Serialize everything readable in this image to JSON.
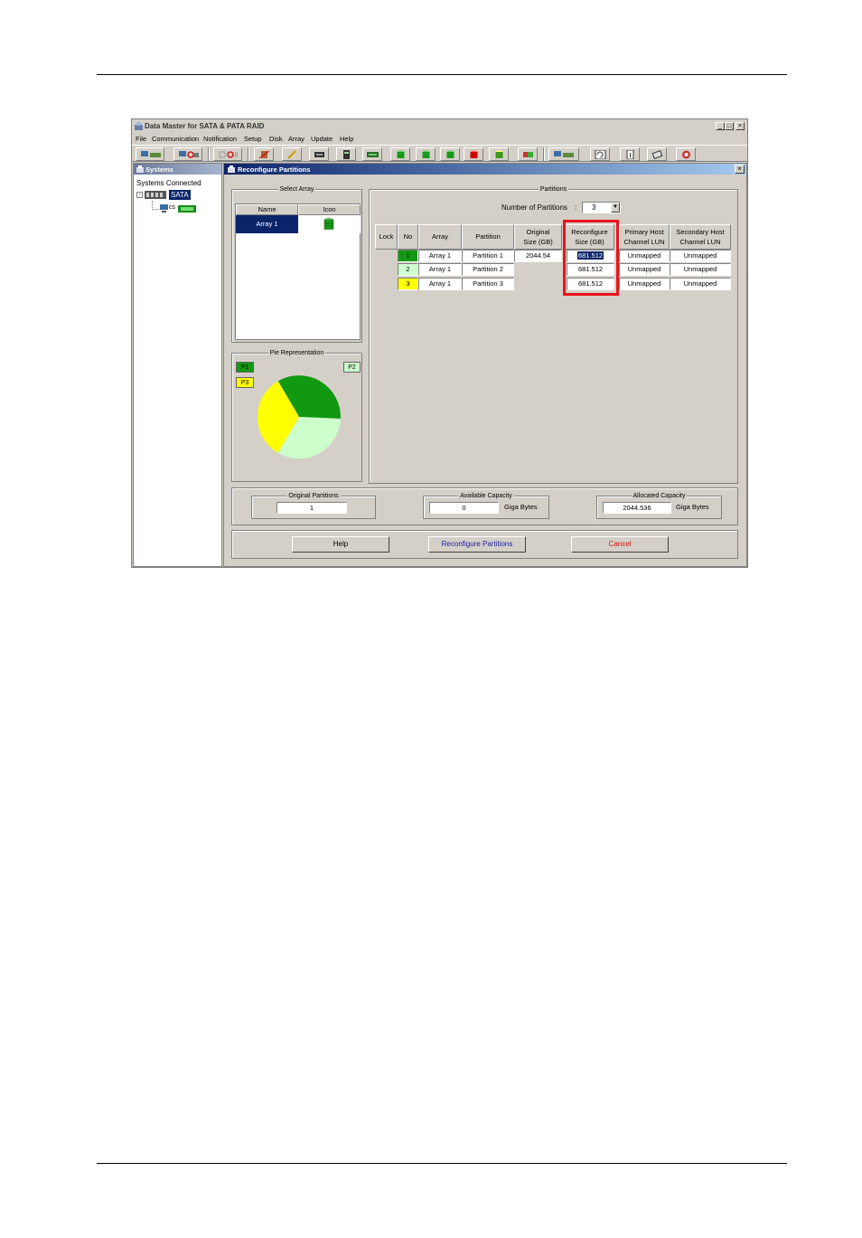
{
  "window": {
    "title": "Data Master for SATA & PATA RAID",
    "controls": {
      "minimize": "_",
      "maximize": "□",
      "close": "×"
    }
  },
  "menu": [
    "File",
    "Communication",
    "Notification",
    "Setup",
    "Disk",
    "Array",
    "Update",
    "Help"
  ],
  "systems_panel": {
    "title": "Systems",
    "root_label": "Systems Connected",
    "node_label": "SATA",
    "child_label": "cs"
  },
  "dialog": {
    "title": "Reconfigure Partitions",
    "close": "×",
    "select_array": {
      "title": "Select Array",
      "headers": [
        "Name",
        "Icon"
      ],
      "rows": [
        {
          "name": "Array 1"
        }
      ]
    },
    "pie": {
      "title": "Pie Representation",
      "legend": [
        "P1",
        "P2",
        "P3"
      ],
      "colors": {
        "p1": "#119911",
        "p2": "#ccffcc",
        "p3": "#ffff00"
      }
    },
    "partitions": {
      "title": "Partitions",
      "count_label": "Number of Partitions",
      "count_colon": ":",
      "count_value": "3",
      "headers": {
        "lock": "Lock",
        "no": "No",
        "array": "Array",
        "partition": "Partition",
        "orig1": "Original",
        "orig2": "Size (GB)",
        "recon1": "Reconfigure",
        "recon2": "Size (GB)",
        "prim1": "Primary Host",
        "prim2": "Channel LUN",
        "sec1": "Secondary Host",
        "sec2": "Channel LUN"
      },
      "rows": [
        {
          "no": "1",
          "array": "Array 1",
          "partition": "Partition 1",
          "original": "2044.54",
          "reconfigure": "681.512",
          "primary": "Unmapped",
          "secondary": "Unmapped"
        },
        {
          "no": "2",
          "array": "Array 1",
          "partition": "Partition 2",
          "original": "",
          "reconfigure": "681.512",
          "primary": "Unmapped",
          "secondary": "Unmapped"
        },
        {
          "no": "3",
          "array": "Array 1",
          "partition": "Partition 3",
          "original": "",
          "reconfigure": "681.512",
          "primary": "Unmapped",
          "secondary": "Unmapped"
        }
      ],
      "row_colors": [
        "#119911",
        "#ccffcc",
        "#ffff00"
      ],
      "highlight_color": "#e8141c"
    },
    "capacity": {
      "original_partitions": {
        "label": "Original Partitions",
        "value": "1"
      },
      "available": {
        "label": "Available Capacity",
        "value": "0",
        "unit": "Giga Bytes"
      },
      "allocated": {
        "label": "Allocated Capacity",
        "value": "2044.536",
        "unit": "Giga Bytes"
      }
    },
    "buttons": {
      "help": "Help",
      "reconfigure": "Reconfigure Partitions",
      "cancel": "Cancel"
    }
  }
}
